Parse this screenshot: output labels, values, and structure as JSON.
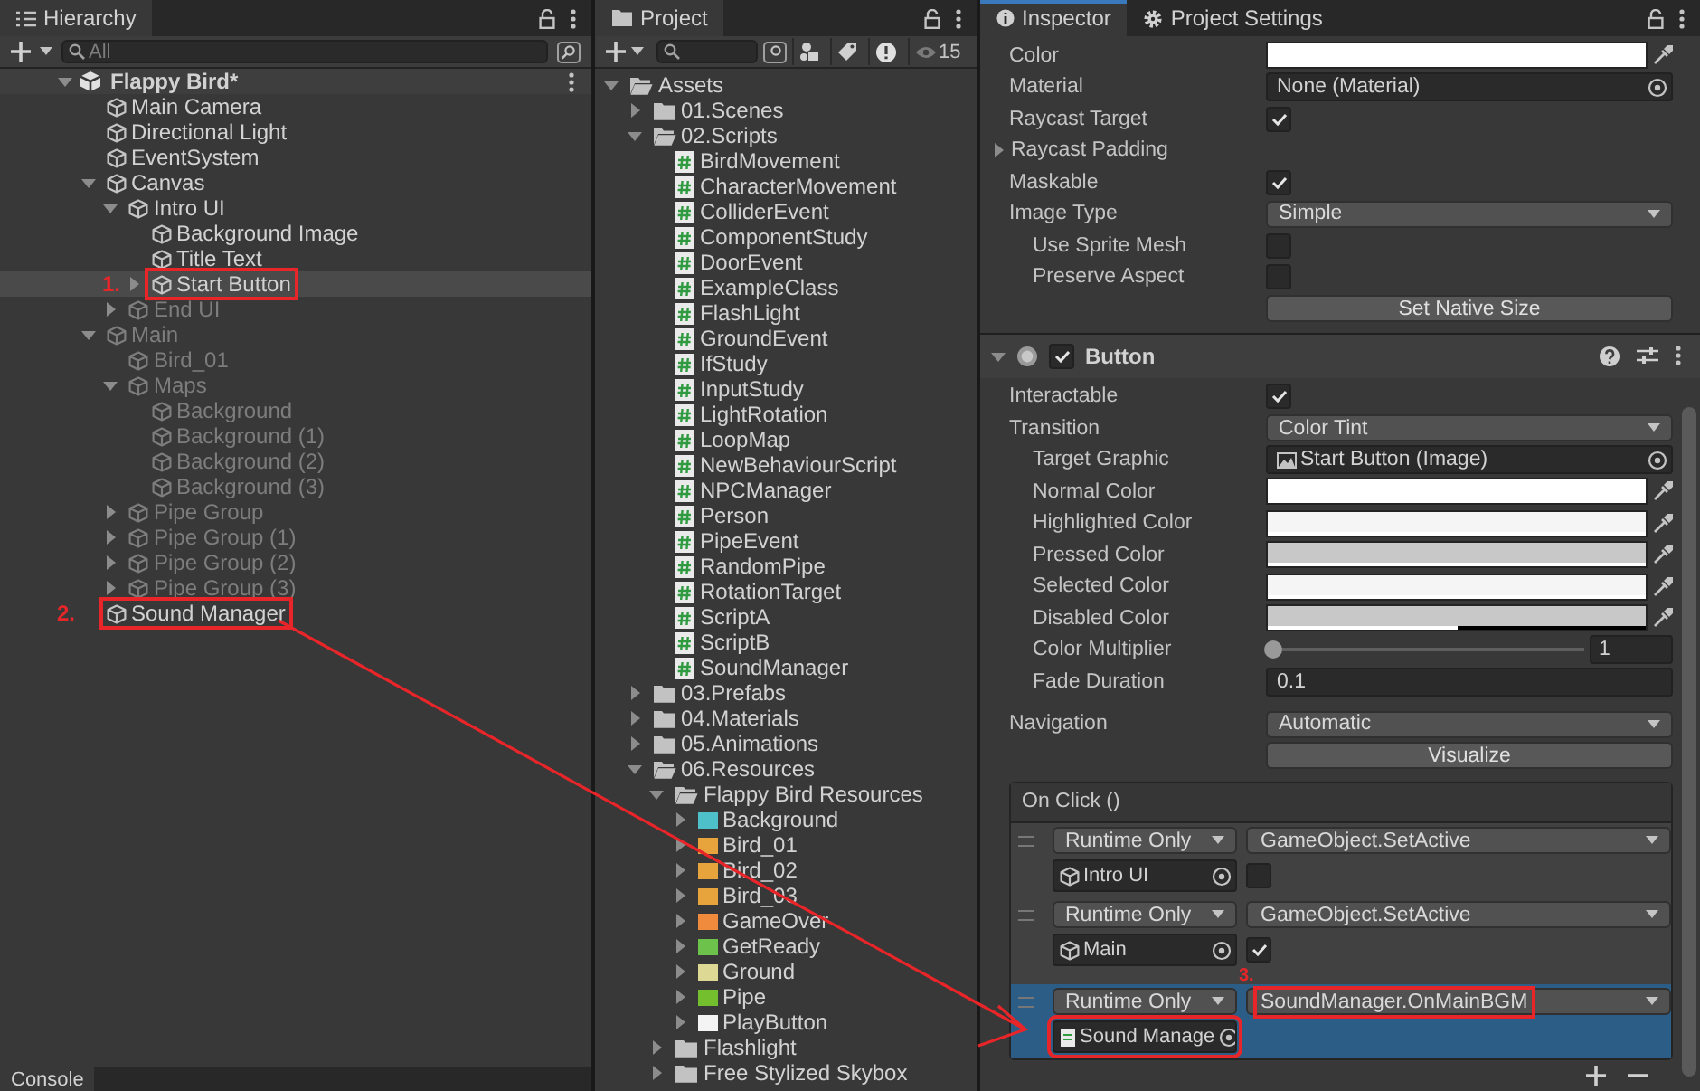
{
  "hierarchy": {
    "tab": "Hierarchy",
    "search": {
      "placeholder": "All"
    },
    "scene": {
      "name": "Flappy Bird*",
      "expanded": true,
      "children": [
        {
          "name": "Main Camera",
          "selected": false,
          "disabled": false
        },
        {
          "name": "Directional Light",
          "selected": false,
          "disabled": false
        },
        {
          "name": "EventSystem",
          "selected": false,
          "disabled": false
        },
        {
          "name": "Canvas",
          "selected": false,
          "disabled": false,
          "expanded": true,
          "children": [
            {
              "name": "Intro UI",
              "selected": false,
              "disabled": false,
              "expanded": true,
              "children": [
                {
                  "name": "Background Image",
                  "selected": false,
                  "disabled": false
                },
                {
                  "name": "Title Text",
                  "selected": false,
                  "disabled": false
                },
                {
                  "name": "Start Button",
                  "selected": true,
                  "disabled": false,
                  "expanded": false,
                  "boxed": true,
                  "annotation": "1."
                }
              ]
            },
            {
              "name": "End UI",
              "selected": false,
              "disabled": true,
              "expanded": false
            }
          ]
        },
        {
          "name": "Main",
          "selected": false,
          "disabled": true,
          "expanded": true,
          "children": [
            {
              "name": "Bird_01",
              "selected": false,
              "disabled": true
            },
            {
              "name": "Maps",
              "selected": false,
              "disabled": true,
              "expanded": true,
              "children": [
                {
                  "name": "Background",
                  "selected": false,
                  "disabled": true
                },
                {
                  "name": "Background (1)",
                  "selected": false,
                  "disabled": true
                },
                {
                  "name": "Background (2)",
                  "selected": false,
                  "disabled": true
                },
                {
                  "name": "Background (3)",
                  "selected": false,
                  "disabled": true
                }
              ]
            },
            {
              "name": "Pipe Group",
              "selected": false,
              "disabled": true,
              "expanded": false
            },
            {
              "name": "Pipe Group (1)",
              "selected": false,
              "disabled": true,
              "expanded": false
            },
            {
              "name": "Pipe Group (2)",
              "selected": false,
              "disabled": true,
              "expanded": false
            },
            {
              "name": "Pipe Group (3)",
              "selected": false,
              "disabled": true,
              "expanded": false
            }
          ]
        },
        {
          "name": "Sound Manager",
          "selected": false,
          "disabled": false,
          "boxed": true,
          "annotation": "2."
        }
      ]
    }
  },
  "console": {
    "tab": "Console"
  },
  "project": {
    "tab": "Project",
    "hidden_count": "15",
    "tree": [
      {
        "name": "Assets",
        "kind": "folder",
        "expanded": true,
        "children": [
          {
            "name": "01.Scenes",
            "kind": "folder",
            "expanded": false
          },
          {
            "name": "02.Scripts",
            "kind": "folder",
            "expanded": true,
            "children": [
              {
                "name": "BirdMovement",
                "kind": "script"
              },
              {
                "name": "CharacterMovement",
                "kind": "script"
              },
              {
                "name": "ColliderEvent",
                "kind": "script"
              },
              {
                "name": "ComponentStudy",
                "kind": "script"
              },
              {
                "name": "DoorEvent",
                "kind": "script"
              },
              {
                "name": "ExampleClass",
                "kind": "script"
              },
              {
                "name": "FlashLight",
                "kind": "script"
              },
              {
                "name": "GroundEvent",
                "kind": "script"
              },
              {
                "name": "IfStudy",
                "kind": "script"
              },
              {
                "name": "InputStudy",
                "kind": "script"
              },
              {
                "name": "LightRotation",
                "kind": "script"
              },
              {
                "name": "LoopMap",
                "kind": "script"
              },
              {
                "name": "NewBehaviourScript",
                "kind": "script"
              },
              {
                "name": "NPCManager",
                "kind": "script"
              },
              {
                "name": "Person",
                "kind": "script"
              },
              {
                "name": "PipeEvent",
                "kind": "script"
              },
              {
                "name": "RandomPipe",
                "kind": "script"
              },
              {
                "name": "RotationTarget",
                "kind": "script"
              },
              {
                "name": "ScriptA",
                "kind": "script"
              },
              {
                "name": "ScriptB",
                "kind": "script"
              },
              {
                "name": "SoundManager",
                "kind": "script"
              }
            ]
          },
          {
            "name": "03.Prefabs",
            "kind": "folder",
            "expanded": false
          },
          {
            "name": "04.Materials",
            "kind": "folder",
            "expanded": false
          },
          {
            "name": "05.Animations",
            "kind": "folder",
            "expanded": false
          },
          {
            "name": "06.Resources",
            "kind": "folder",
            "expanded": true,
            "children": [
              {
                "name": "Flappy Bird Resources",
                "kind": "folder",
                "expanded": true,
                "children": [
                  {
                    "name": "Background",
                    "kind": "sprite",
                    "color": "#4ec0ca",
                    "expanded": false
                  },
                  {
                    "name": "Bird_01",
                    "kind": "sprite",
                    "color": "#e8a43c",
                    "expanded": false
                  },
                  {
                    "name": "Bird_02",
                    "kind": "sprite",
                    "color": "#e8a43c",
                    "expanded": false
                  },
                  {
                    "name": "Bird_03",
                    "kind": "sprite",
                    "color": "#e8a43c",
                    "expanded": false
                  },
                  {
                    "name": "GameOver",
                    "kind": "sprite",
                    "color": "#f08a3c",
                    "expanded": false
                  },
                  {
                    "name": "GetReady",
                    "kind": "sprite",
                    "color": "#6cc24a",
                    "expanded": false
                  },
                  {
                    "name": "Ground",
                    "kind": "sprite",
                    "color": "#ded895",
                    "expanded": false
                  },
                  {
                    "name": "Pipe",
                    "kind": "sprite",
                    "color": "#74bf2e",
                    "expanded": false
                  },
                  {
                    "name": "PlayButton",
                    "kind": "sprite",
                    "color": "#f4f4f4",
                    "expanded": false
                  }
                ]
              },
              {
                "name": "Flashlight",
                "kind": "folder",
                "expanded": false
              },
              {
                "name": "Free Stylized Skybox",
                "kind": "folder",
                "expanded": false
              }
            ]
          }
        ]
      }
    ]
  },
  "inspector": {
    "tabs": [
      {
        "label": "Inspector",
        "selected": true
      },
      {
        "label": "Project Settings",
        "selected": false
      }
    ],
    "image_fields": [
      {
        "label": "Color",
        "kind": "color",
        "color": "#ffffff",
        "level": 1
      },
      {
        "label": "Material",
        "kind": "object",
        "value": "None (Material)"
      },
      {
        "label": "Raycast Target",
        "kind": "checkbox",
        "checked": true
      },
      {
        "label": "Raycast Padding",
        "kind": "foldout",
        "expanded": false
      },
      {
        "label": "Maskable",
        "kind": "checkbox",
        "checked": true
      },
      {
        "label": "Image Type",
        "kind": "dropdown",
        "value": "Simple",
        "children": [
          {
            "label": "Use Sprite Mesh",
            "kind": "checkbox",
            "checked": false
          },
          {
            "label": "Preserve Aspect",
            "kind": "checkbox",
            "checked": false
          }
        ]
      },
      {
        "kind": "button",
        "value": "Set Native Size"
      }
    ],
    "component": {
      "name": "Button",
      "enabled": true,
      "expanded": true
    },
    "button_fields": [
      {
        "label": "Interactable",
        "kind": "checkbox",
        "checked": true
      },
      {
        "label": "Transition",
        "kind": "dropdown",
        "value": "Color Tint",
        "children": [
          {
            "label": "Target Graphic",
            "kind": "image_object",
            "value": "Start Button (Image)"
          },
          {
            "label": "Normal Color",
            "kind": "color",
            "color": "#ffffff",
            "level": 1
          },
          {
            "label": "Highlighted Color",
            "kind": "color",
            "color": "#f5f5f5",
            "level": 1
          },
          {
            "label": "Pressed Color",
            "kind": "color",
            "color": "#c8c8c8",
            "level": 1
          },
          {
            "label": "Selected Color",
            "kind": "color",
            "color": "#f5f5f5",
            "level": 1
          },
          {
            "label": "Disabled Color",
            "kind": "color",
            "color": "#c8c8c8",
            "level": 0.5
          },
          {
            "label": "Color Multiplier",
            "kind": "slider",
            "level": 0,
            "value": "1"
          },
          {
            "label": "Fade Duration",
            "kind": "number",
            "value": "0.1"
          }
        ]
      },
      {
        "label": "Navigation",
        "kind": "dropdown",
        "value": "Automatic"
      },
      {
        "kind": "button",
        "value": "Visualize"
      }
    ],
    "on_click": {
      "title": "On Click ()",
      "entries": [
        {
          "runtime": "Runtime Only",
          "function": "GameObject.SetActive",
          "target": {
            "kind": "gameobject",
            "value": "Intro UI"
          },
          "argument": {
            "checked": false
          },
          "selected": false
        },
        {
          "runtime": "Runtime Only",
          "function": "GameObject.SetActive",
          "target": {
            "kind": "gameobject",
            "value": "Main"
          },
          "argument": {
            "checked": true
          },
          "selected": false
        },
        {
          "runtime": "Runtime Only",
          "function": "SoundManager.OnMainBGM",
          "target": {
            "kind": "script",
            "value": "Sound Manage"
          },
          "selected": true,
          "function_boxed": true,
          "target_boxed": true,
          "annotation": "3."
        }
      ]
    }
  }
}
